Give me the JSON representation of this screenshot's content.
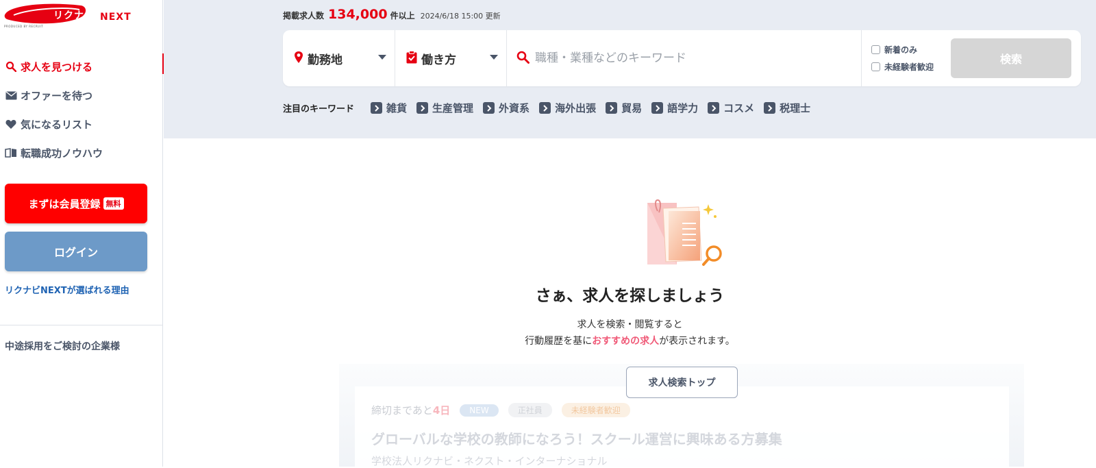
{
  "brand": {
    "name": "リクナビ",
    "suffix": "NEXT",
    "produced_by": "PRODUCED BY RECRUIT"
  },
  "sidebar": {
    "items": [
      {
        "label": "求人を見つける",
        "icon": "search-icon",
        "active": true
      },
      {
        "label": "オファーを待つ",
        "icon": "mail-icon",
        "active": false
      },
      {
        "label": "気になるリスト",
        "icon": "heart-icon",
        "active": false
      },
      {
        "label": "転職成功ノウハウ",
        "icon": "book-icon",
        "active": false
      }
    ],
    "register_label": "まずは会員登録",
    "register_badge": "無料",
    "login_label": "ログイン",
    "why_link": "リクナビNEXTが選ばれる理由",
    "corporate_link": "中途採用をご検討の企業様"
  },
  "header": {
    "count_label": "掲載求人数",
    "count_value": "134,000",
    "count_suffix": "件以上",
    "updated": "2024/6/18 15:00 更新"
  },
  "search": {
    "location_label": "勤務地",
    "work_style_label": "働き方",
    "keyword_placeholder": "職種・業種などのキーワード",
    "check_new_only": "新着のみ",
    "check_inexperienced": "未経験者歓迎",
    "search_button": "検索"
  },
  "keywords": {
    "title": "注目のキーワード",
    "tags": [
      "雑貨",
      "生産管理",
      "外資系",
      "海外出張",
      "貿易",
      "語学力",
      "コスメ",
      "税理士"
    ]
  },
  "empty_state": {
    "title": "さぁ、求人を探しましょう",
    "desc_line1": "求人を検索・閲覧すると",
    "desc_line2_before": "行動履歴を基に",
    "desc_line2_highlight": "おすすめの求人",
    "desc_line2_after": "が表示されます。",
    "button": "求人検索トップ"
  },
  "ghost_card": {
    "deadline_prefix": "締切まであと",
    "deadline_days": "4日",
    "pill_new": "NEW",
    "pill_employment": "正社員",
    "pill_inexperienced": "未経験者歓迎",
    "title": "グローバルな学校の教師になろう！スクール運営に興味ある方募集",
    "company": "学校法人リクナビ・ネクスト・インターナショナル"
  },
  "colors": {
    "brand_red": "#e60012",
    "login_blue": "#6d9ac8",
    "highlight_pink": "#f05a78",
    "band_bg": "#e8ecf3"
  }
}
